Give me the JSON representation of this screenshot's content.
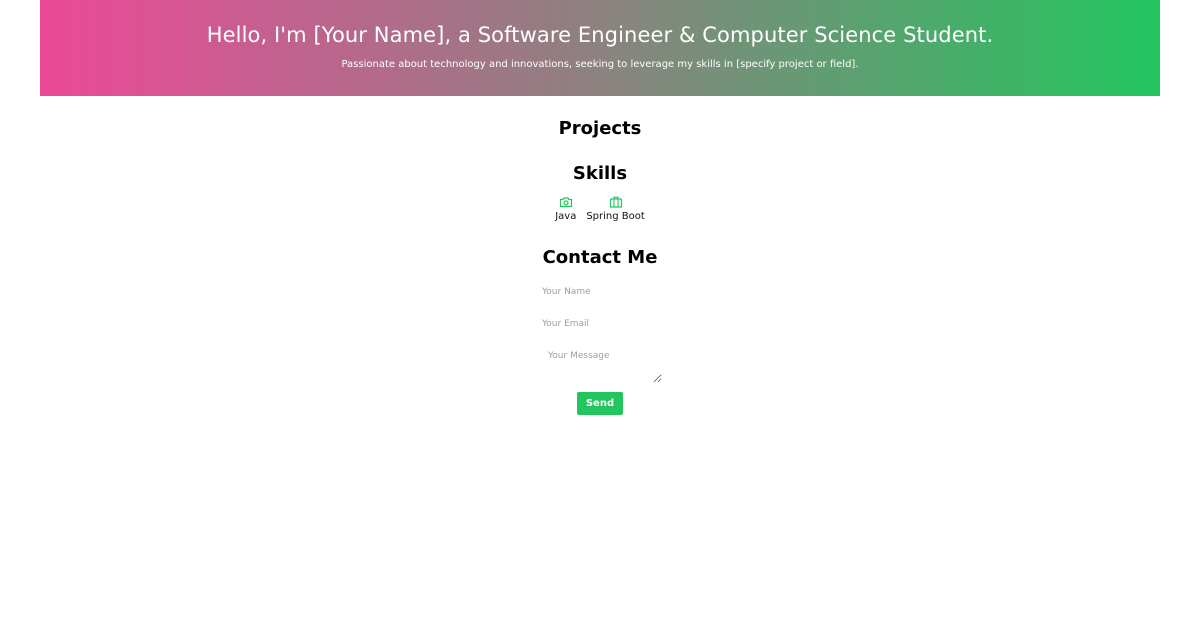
{
  "hero": {
    "title": "Hello, I'm [Your Name], a Software Engineer & Computer Science Student.",
    "subtitle": "Passionate about technology and innovations, seeking to leverage my skills in [specify project or field].",
    "gradient_start": "#ec4899",
    "gradient_end": "#22c55e"
  },
  "projects": {
    "heading": "Projects"
  },
  "skills": {
    "heading": "Skills",
    "icon_color": "#22c55e",
    "items": [
      {
        "label": "Java",
        "icon": "camera-icon"
      },
      {
        "label": "Spring Boot",
        "icon": "briefcase-icon"
      }
    ]
  },
  "contact": {
    "heading": "Contact Me",
    "name_placeholder": "Your Name",
    "email_placeholder": "Your Email",
    "message_placeholder": "Your Message",
    "send_label": "Send",
    "accent": "#22c55e"
  }
}
